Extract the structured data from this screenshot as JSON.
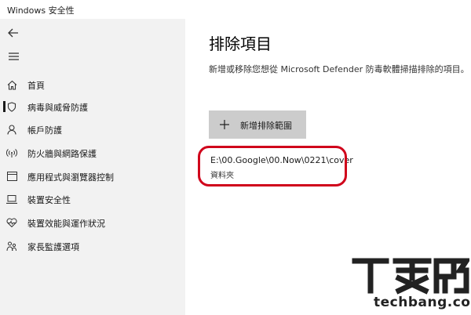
{
  "window": {
    "title": "Windows 安全性"
  },
  "sidebar": {
    "back_icon": "back-arrow-icon",
    "menu_icon": "hamburger-menu-icon",
    "items": [
      {
        "label": "首頁",
        "icon": "home-icon"
      },
      {
        "label": "病毒與威脅防護",
        "icon": "shield-icon",
        "active": true
      },
      {
        "label": "帳戶防護",
        "icon": "person-icon"
      },
      {
        "label": "防火牆與網路保護",
        "icon": "wifi-antenna-icon"
      },
      {
        "label": "應用程式與瀏覽器控制",
        "icon": "app-window-icon"
      },
      {
        "label": "裝置安全性",
        "icon": "laptop-icon"
      },
      {
        "label": "裝置效能與運作狀況",
        "icon": "heart-pulse-icon"
      },
      {
        "label": "家長監護選項",
        "icon": "family-icon"
      }
    ]
  },
  "main": {
    "title": "排除項目",
    "description": "新增或移除您想從 Microsoft Defender 防毒軟體掃描排除的項目。",
    "add_button_label": "新增排除範圍",
    "exclusion": {
      "path": "E:\\00.Google\\00.Now\\0221\\cover",
      "type": "資料夾"
    }
  },
  "colors": {
    "highlight": "#d0021b",
    "sidebar_bg": "#f2f2f2",
    "button_bg": "#cccccc"
  },
  "watermark": {
    "text": "techbang.com"
  }
}
